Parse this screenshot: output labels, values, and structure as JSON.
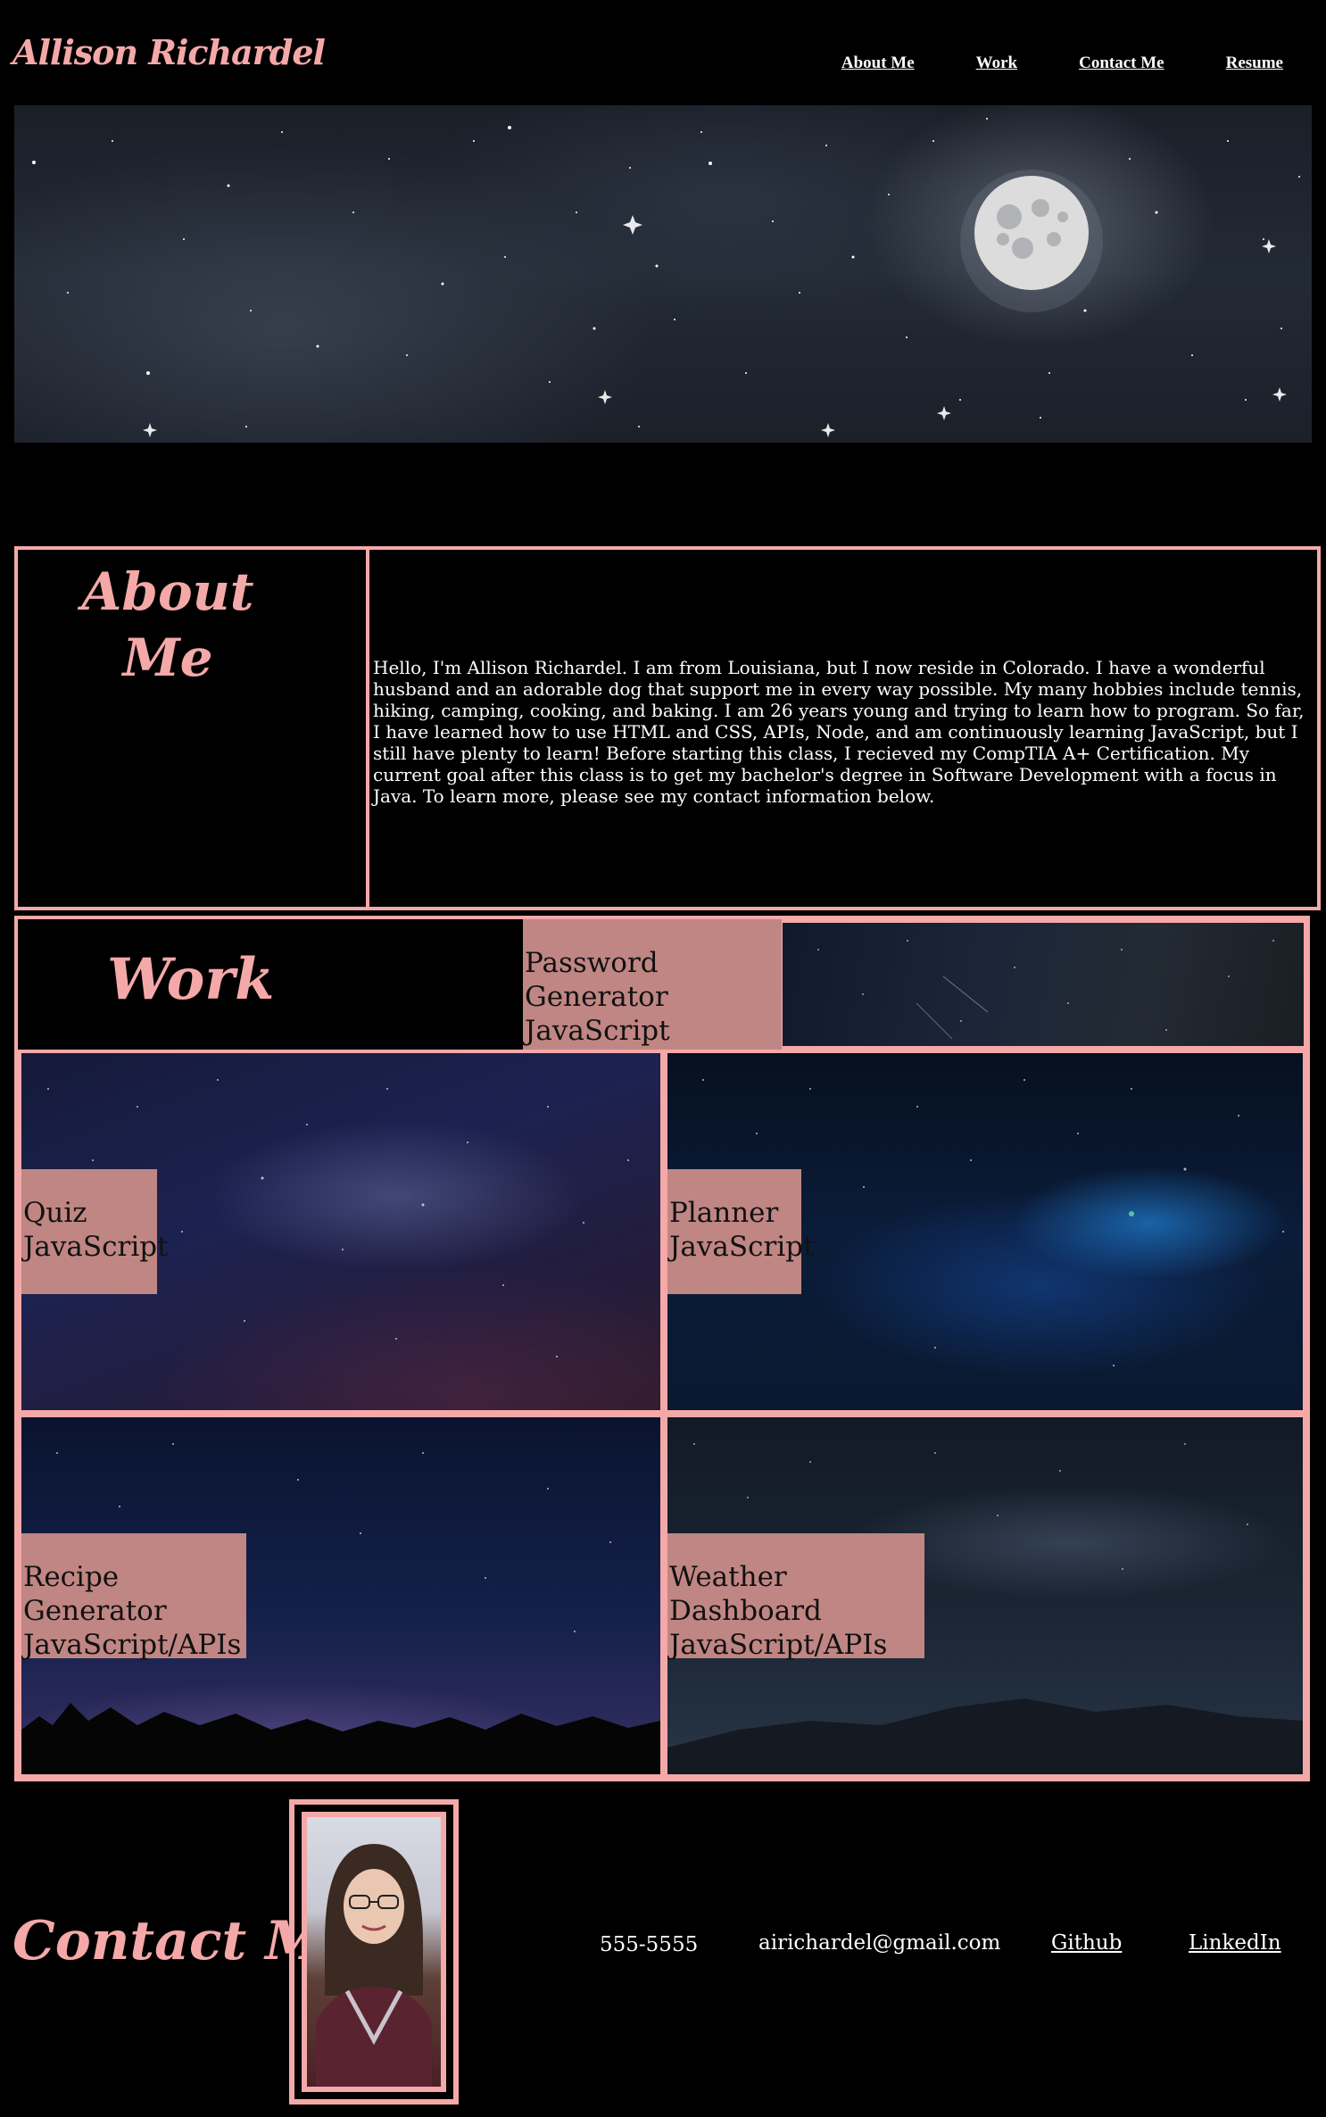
{
  "header": {
    "brand": "Allison Richardel",
    "nav": [
      "About Me",
      "Work",
      "Contact Me",
      "Resume"
    ]
  },
  "hero": {
    "description": "night sky with moon"
  },
  "about": {
    "title_line1": "About",
    "title_line2": "Me",
    "text": "Hello, I'm Allison Richardel. I am from Louisiana, but I now reside in Colorado. I have a wonderful husband and an adorable dog that support me in every way possible. My many hobbies include tennis, hiking, camping, cooking, and baking. I am 26 years young and trying to learn how to program. So far, I have learned how to use HTML and CSS, APIs, Node, and am continuously learning JavaScript, but I still have plenty to learn! Before starting this class, I recieved my CompTIA A+ Certification. My current goal after this class is to get my bachelor's degree in Software Development with a focus in Java. To learn more, please see my contact information below."
  },
  "work": {
    "title": "Work",
    "projects": [
      {
        "name": "Password Generator",
        "tech": "JavaScript"
      },
      {
        "name": "Quiz",
        "tech": "JavaScript"
      },
      {
        "name": "Planner",
        "tech": "JavaScript"
      },
      {
        "name": "Recipe Generator",
        "tech": "JavaScript/APIs"
      },
      {
        "name": "Weather Dashboard",
        "tech": "JavaScript/APIs"
      }
    ]
  },
  "contact": {
    "title": "Contact Me:",
    "phone": "555-5555",
    "email": "airichardel@gmail.com",
    "github": "Github",
    "linkedin": "LinkedIn"
  },
  "colors": {
    "accent": "#f4a9a8",
    "label_bg": "#c08683",
    "background": "#000000"
  }
}
